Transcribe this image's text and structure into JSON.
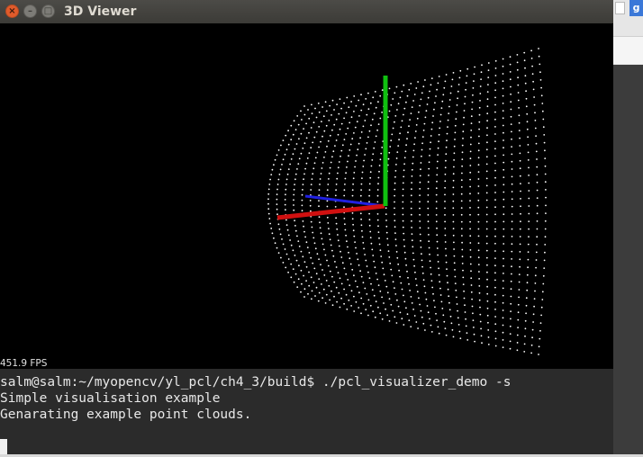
{
  "viewer": {
    "title": "3D Viewer",
    "fps": "451.9 FPS",
    "buttons": {
      "close": "×",
      "minimize": "–",
      "maximize": "□"
    },
    "axes_colors": {
      "x": "#d01010",
      "y": "#10c010",
      "z": "#2020e0"
    },
    "points_color": "#ffffff"
  },
  "terminal": {
    "lines": [
      "salm@salm:~/myopencv/yl_pcl/ch4_3/build$ ./pcl_visualizer_demo -s",
      "Simple visualisation example",
      "Genarating example point clouds."
    ]
  },
  "background_app": {
    "icon_label": "g"
  }
}
